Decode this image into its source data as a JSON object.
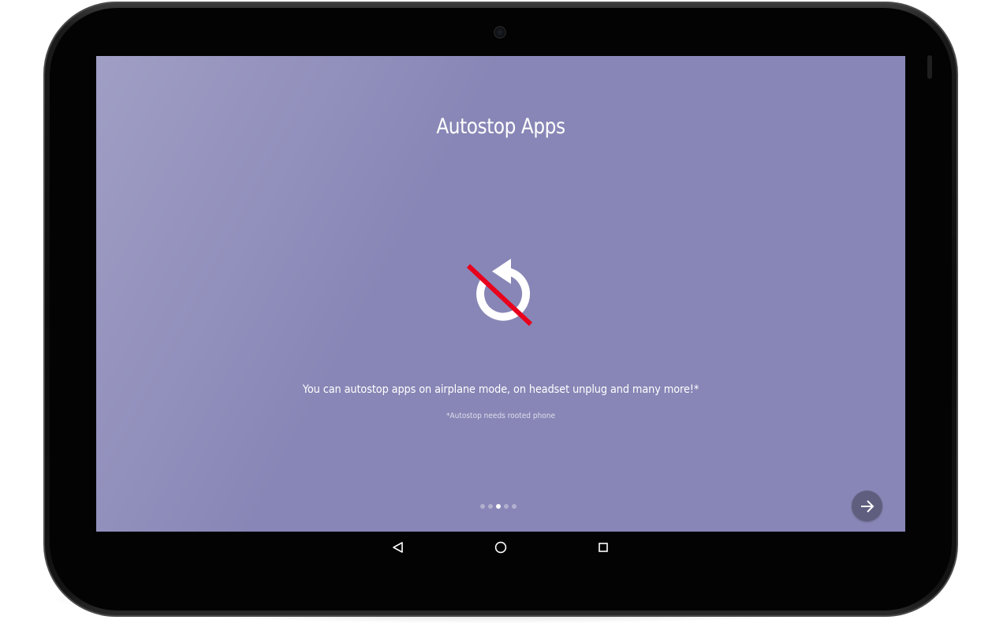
{
  "onboarding": {
    "title": "Autostop Apps",
    "feature_icon": "autostop-disabled-icon",
    "description": "You can autostop apps on airplane mode, on headset unplug and many more!*",
    "note": "*Autostop needs rooted phone",
    "pager": {
      "total": 5,
      "current": 3
    },
    "next_icon": "arrow-right-icon"
  },
  "system_nav": {
    "back_icon": "back-triangle-icon",
    "home_icon": "home-circle-icon",
    "recents_icon": "recents-square-icon"
  },
  "colors": {
    "screen_bg": "#8886b6",
    "next_button_bg": "#5f5e7e",
    "strike_red": "#e8001c",
    "device_bezel": "#0d0d0d"
  }
}
